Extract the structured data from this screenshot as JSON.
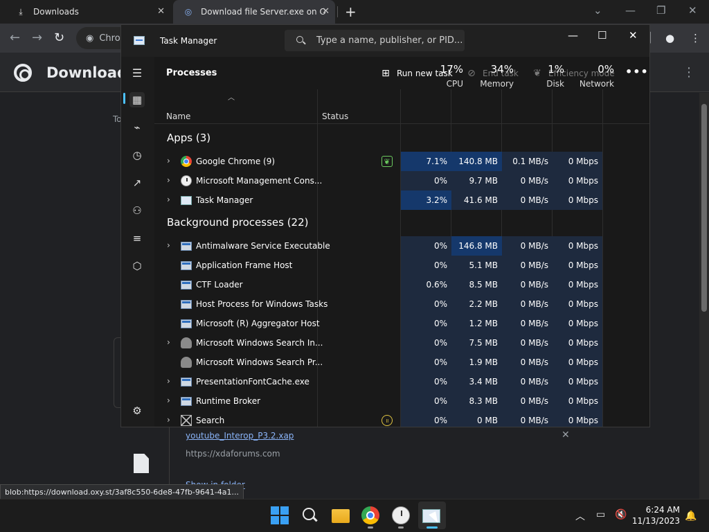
{
  "browser": {
    "tabs": [
      {
        "title": "Downloads",
        "close": "✕"
      },
      {
        "title": "Download file Server.exe on Oxy",
        "close": "✕"
      }
    ],
    "new_tab": "+",
    "omnibox_text": "Chro",
    "page_title": "Downloads",
    "side_text": "To",
    "download_item": {
      "filename": "youtube_Interop_P3.2.xap",
      "url": "https://xdaforums.com",
      "action": "Show in folder",
      "close": "✕"
    },
    "status_url": "blob:https://download.oxy.st/3af8c550-6de8-47fb-9641-4a1..."
  },
  "task_manager": {
    "title": "Task Manager",
    "search_placeholder": "Type a name, publisher, or PID...",
    "controls": {
      "minimize": "—",
      "maximize": "☐",
      "close": "✕"
    },
    "heading": "Processes",
    "commands": {
      "run_new_task": "Run new task",
      "end_task": "End task",
      "efficiency_mode": "Efficiency mode",
      "more": "•••"
    },
    "columns": {
      "name": "Name",
      "status": "Status",
      "cpu": {
        "pct": "17%",
        "label": "CPU"
      },
      "memory": {
        "pct": "34%",
        "label": "Memory"
      },
      "disk": {
        "pct": "1%",
        "label": "Disk"
      },
      "network": {
        "pct": "0%",
        "label": "Network"
      }
    },
    "groups": {
      "apps": "Apps (3)",
      "background": "Background processes (22)"
    },
    "apps": [
      {
        "name": "Google Chrome (9)",
        "cpu": "7.1%",
        "mem": "140.8 MB",
        "disk": "0.1 MB/s",
        "net": "0 Mbps"
      },
      {
        "name": "Microsoft Management Cons...",
        "cpu": "0%",
        "mem": "9.7 MB",
        "disk": "0 MB/s",
        "net": "0 Mbps"
      },
      {
        "name": "Task Manager",
        "cpu": "3.2%",
        "mem": "41.6 MB",
        "disk": "0 MB/s",
        "net": "0 Mbps"
      }
    ],
    "background": [
      {
        "name": "Antimalware Service Executable",
        "cpu": "0%",
        "mem": "146.8 MB",
        "disk": "0 MB/s",
        "net": "0 Mbps"
      },
      {
        "name": "Application Frame Host",
        "cpu": "0%",
        "mem": "5.1 MB",
        "disk": "0 MB/s",
        "net": "0 Mbps"
      },
      {
        "name": "CTF Loader",
        "cpu": "0.6%",
        "mem": "8.5 MB",
        "disk": "0 MB/s",
        "net": "0 Mbps"
      },
      {
        "name": "Host Process for Windows Tasks",
        "cpu": "0%",
        "mem": "2.2 MB",
        "disk": "0 MB/s",
        "net": "0 Mbps"
      },
      {
        "name": "Microsoft (R) Aggregator Host",
        "cpu": "0%",
        "mem": "1.2 MB",
        "disk": "0 MB/s",
        "net": "0 Mbps"
      },
      {
        "name": "Microsoft Windows Search In...",
        "cpu": "0%",
        "mem": "7.5 MB",
        "disk": "0 MB/s",
        "net": "0 Mbps"
      },
      {
        "name": "Microsoft Windows Search Pr...",
        "cpu": "0%",
        "mem": "1.9 MB",
        "disk": "0 MB/s",
        "net": "0 Mbps"
      },
      {
        "name": "PresentationFontCache.exe",
        "cpu": "0%",
        "mem": "3.4 MB",
        "disk": "0 MB/s",
        "net": "0 Mbps"
      },
      {
        "name": "Runtime Broker",
        "cpu": "0%",
        "mem": "8.3 MB",
        "disk": "0 MB/s",
        "net": "0 Mbps"
      },
      {
        "name": "Search",
        "cpu": "0%",
        "mem": "0 MB",
        "disk": "0 MB/s",
        "net": "0 Mbps"
      }
    ],
    "colors": {
      "heat_low": "#1e2a3e",
      "heat_mid": "#15386b",
      "accent": "#4cc2ff"
    }
  },
  "taskbar": {
    "time": "6:24 AM",
    "date": "11/13/2023"
  }
}
